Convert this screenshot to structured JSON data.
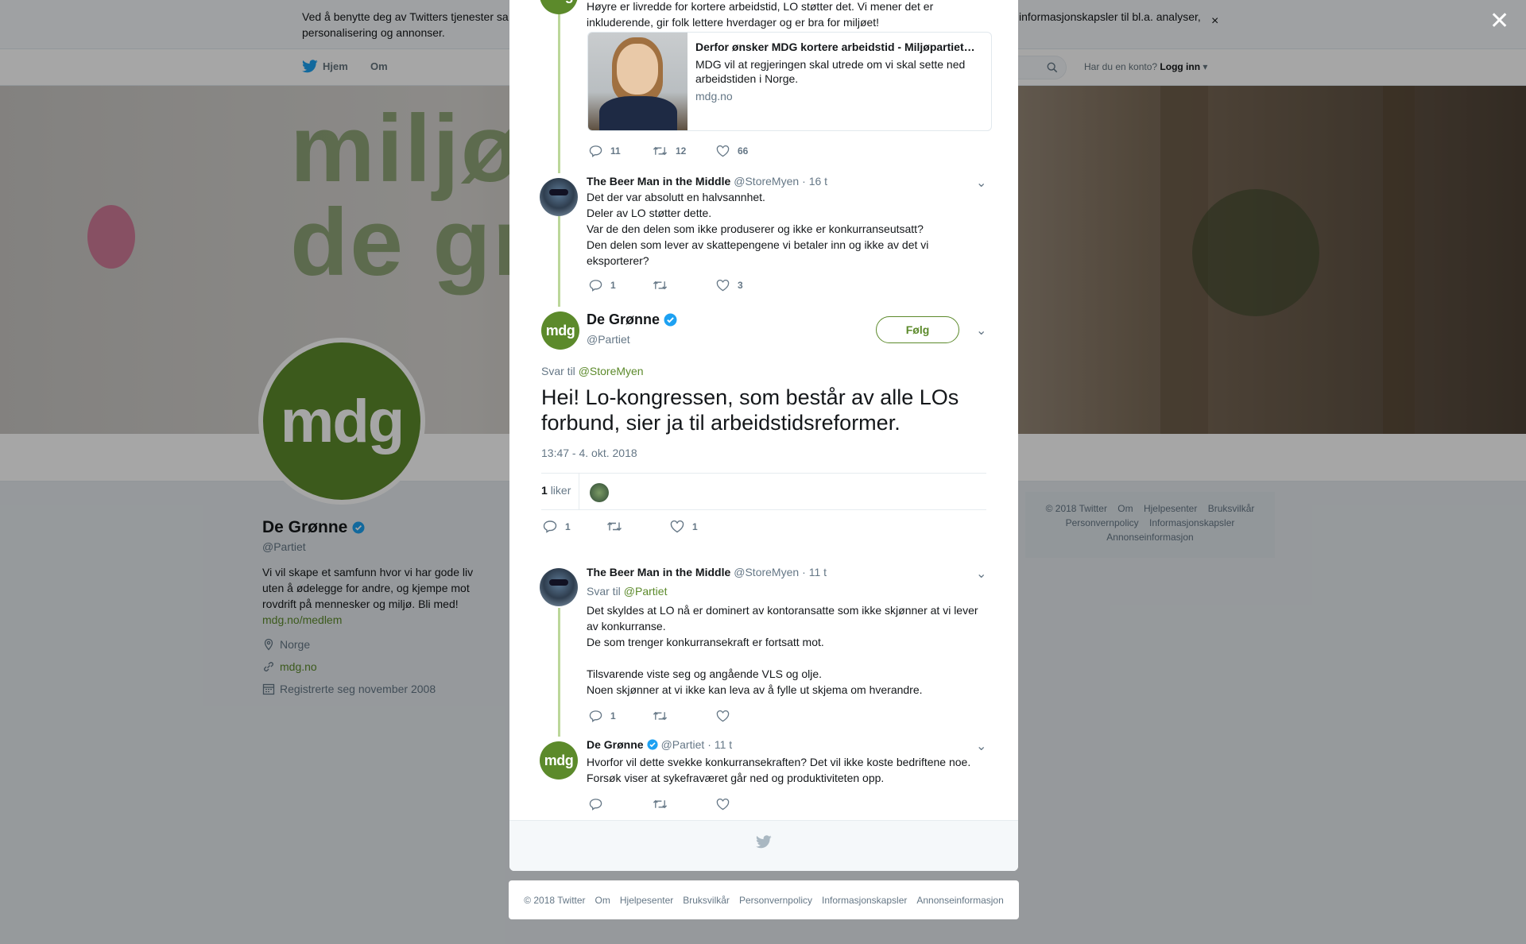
{
  "cookie": {
    "text": "Ved å benytte deg av Twitters tjenester sa… informasjonskapsler til bl.a. analyser, personalisering og annonser.",
    "text_left": "Ved å benytte deg av Twitters tjenester sa",
    "text_right": "informasjonskapsler til bl.a. analyser,",
    "text_line2": "personalisering og annonser.",
    "close": "×"
  },
  "nav": {
    "home": "Hjem",
    "about": "Om",
    "account_prompt": "Har du en konto?",
    "login": "Logg inn"
  },
  "banner": {
    "wordmark_line1": "miljøpa",
    "wordmark_line2": "de grø"
  },
  "profile": {
    "avatar": "mdg",
    "name": "De Grønne",
    "handle": "@Partiet",
    "bio": "Vi vil skape et samfunn hvor vi har gode liv uten å ødelegge for andre, og kjempe mot rovdrift på mennesker og miljø. Bli med!",
    "bio_link": "mdg.no/medlem",
    "location": "Norge",
    "website": "mdg.no",
    "joined": "Registrerte seg november 2008"
  },
  "right_footer": {
    "items": [
      "© 2018 Twitter",
      "Om",
      "Hjelpesenter",
      "Bruksvilkår",
      "Personvernpolicy",
      "Informasjonskapsler",
      "Annonseinformasjon"
    ]
  },
  "overlay_close": "✕",
  "tweets": {
    "t1": {
      "text": "Høyre er livredde for kortere arbeidstid, LO støtter det. Vi mener det er\ninkluderende, gir folk lettere hverdager og er bra for miljøet!",
      "card_title": "Derfor ønsker MDG kortere arbeidstid - Miljøpartiet…",
      "card_desc": "MDG vil at regjeringen skal utrede om vi skal sette ned arbeidstiden i Norge.",
      "card_domain": "mdg.no",
      "replies": "11",
      "retweets": "12",
      "likes": "66"
    },
    "t2": {
      "name": "The Beer Man in the Middle",
      "handle": "@StoreMyen",
      "time": "· 16 t",
      "text": "Det der var absolutt en halvsannhet.\nDeler av LO støtter dette.\nVar de den delen som ikke produserer og ikke er konkurranseutsatt?\nDen delen som lever av skattepengene vi betaler inn og ikke av det vi\neksporterer?",
      "replies": "1",
      "retweets": "",
      "likes": "3"
    },
    "main": {
      "avatar": "mdg",
      "name": "De Grønne",
      "handle": "@Partiet",
      "follow": "Følg",
      "reply_prefix": "Svar til",
      "reply_to": "@StoreMyen",
      "text": "Hei! Lo-kongressen, som består av alle LOs forbund, sier ja til arbeidstidsreformer.",
      "timestamp": "13:47 - 4. okt. 2018",
      "likes_count": "1",
      "likes_label": "liker",
      "replies": "1",
      "retweets": "",
      "likes": "1"
    },
    "t3": {
      "name": "The Beer Man in the Middle",
      "handle": "@StoreMyen",
      "time": "· 11 t",
      "reply_prefix": "Svar til",
      "reply_to": "@Partiet",
      "text": "Det skyldes at LO nå er dominert av kontoransatte som ikke skjønner at vi lever\nav konkurranse.\nDe som trenger konkurransekraft er fortsatt mot.\n\nTilsvarende viste seg og angående VLS og olje.\nNoen skjønner at vi ikke kan leva av å fylle ut skjema om hverandre.",
      "replies": "1",
      "retweets": "",
      "likes": ""
    },
    "t4": {
      "avatar": "mdg",
      "name": "De Grønne",
      "handle": "@Partiet",
      "time": "· 11 t",
      "text": "Hvorfor vil dette svekke konkurransekraften? Det vil ikke koste bedriftene noe.\nForsøk viser at sykefraværet går ned og produktiviteten opp.",
      "replies": "",
      "retweets": "",
      "likes": ""
    }
  },
  "bottom_footer": {
    "items": [
      "© 2018 Twitter",
      "Om",
      "Hjelpesenter",
      "Bruksvilkår",
      "Personvernpolicy",
      "Informasjonskapsler",
      "Annonseinformasjon"
    ]
  },
  "colors": {
    "brand_green": "#5c8a2b",
    "verified_blue": "#1da1f2",
    "thread_line": "#bcd79a"
  },
  "icons": [
    "twitter-bird-icon",
    "search-icon",
    "verified-badge-icon",
    "reply-icon",
    "retweet-icon",
    "like-icon",
    "chevron-down-icon",
    "location-icon",
    "link-icon",
    "calendar-icon",
    "close-icon"
  ]
}
